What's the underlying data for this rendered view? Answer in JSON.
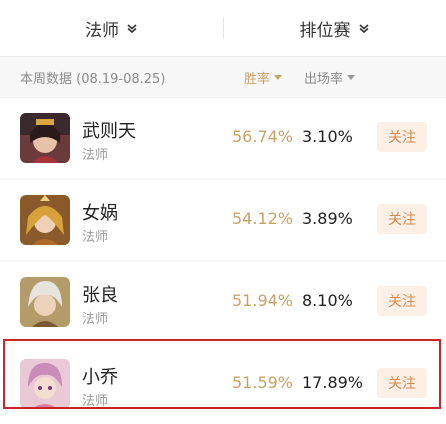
{
  "topbar": {
    "role_filter": "法师",
    "mode_filter": "排位赛"
  },
  "subhead": {
    "week_label": "本周数据 (08.19-08.25)",
    "win_rate_label": "胜率",
    "pick_rate_label": "出场率"
  },
  "heroes": [
    {
      "name": "武则天",
      "role": "法师",
      "win_rate": "56.74%",
      "pick_rate": "3.10%",
      "follow": "关注"
    },
    {
      "name": "女娲",
      "role": "法师",
      "win_rate": "54.12%",
      "pick_rate": "3.89%",
      "follow": "关注"
    },
    {
      "name": "张良",
      "role": "法师",
      "win_rate": "51.94%",
      "pick_rate": "8.10%",
      "follow": "关注"
    },
    {
      "name": "小乔",
      "role": "法师",
      "win_rate": "51.59%",
      "pick_rate": "17.89%",
      "follow": "关注"
    }
  ],
  "colors": {
    "accent": "#c9a166",
    "follow_bg": "#fbefe6",
    "follow_text": "#d7894f",
    "highlight_border": "#c8252a"
  }
}
